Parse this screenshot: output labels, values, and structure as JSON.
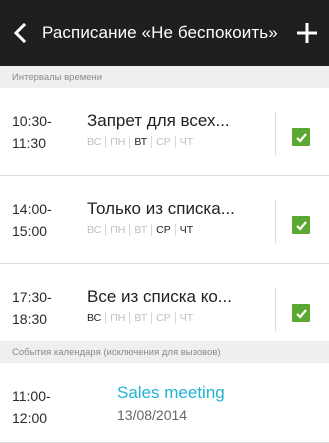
{
  "header": {
    "title": "Расписание «Не беспокоить»",
    "back_icon": "chevron-left-icon",
    "add_icon": "plus-icon"
  },
  "sections": {
    "intervals_label": "Интервалы времени",
    "calendar_label": "События календаря (исключения для вызовов)"
  },
  "rules": [
    {
      "start": "10:30-",
      "end": "11:30",
      "name": "Запрет для всех...",
      "days": [
        {
          "label": "ВС",
          "active": false
        },
        {
          "label": "ПН",
          "active": false
        },
        {
          "label": "ВТ",
          "active": true
        },
        {
          "label": "СР",
          "active": false
        },
        {
          "label": "ЧТ",
          "active": false
        }
      ],
      "checked": true
    },
    {
      "start": "14:00-",
      "end": "15:00",
      "name": "Только из списка...",
      "days": [
        {
          "label": "ВС",
          "active": false
        },
        {
          "label": "ПН",
          "active": false
        },
        {
          "label": "ВТ",
          "active": false
        },
        {
          "label": "СР",
          "active": true
        },
        {
          "label": "ЧТ",
          "active": true
        }
      ],
      "checked": true
    },
    {
      "start": "17:30-",
      "end": "18:30",
      "name": "Все из списка ко...",
      "days": [
        {
          "label": "ВС",
          "active": true
        },
        {
          "label": "ПН",
          "active": false
        },
        {
          "label": "ВТ",
          "active": false
        },
        {
          "label": "СР",
          "active": false
        },
        {
          "label": "ЧТ",
          "active": false
        }
      ],
      "checked": true
    }
  ],
  "event": {
    "start": "11:00-",
    "end": "12:00",
    "title": "Sales meeting",
    "date": "13/08/2014"
  },
  "colors": {
    "topbar": "#1f1f1f",
    "checkbox": "#5aa832",
    "event_title": "#1fb3d0",
    "day_active": "#222222",
    "day_inactive": "#c0c0c0"
  }
}
